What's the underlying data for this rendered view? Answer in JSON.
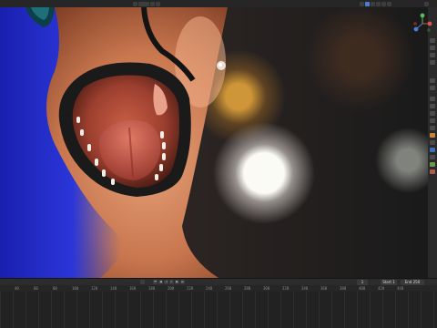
{
  "header": {
    "options_label": "Options",
    "icons": [
      "camera-icon",
      "select-icon",
      "overlay-icon",
      "shading-solid-icon",
      "shading-material-icon",
      "shading-rendered-icon"
    ]
  },
  "viewport": {
    "description_label": ""
  },
  "gizmo": {
    "x_label": "X",
    "y_label": "Y",
    "z_label": "Z"
  },
  "timeline": {
    "start_label": "Start",
    "start_value": "1",
    "end_label": "End",
    "end_value": "250",
    "current_frame": "1",
    "ticks": [
      "40",
      "60",
      "80",
      "100",
      "120",
      "140",
      "160",
      "180",
      "200",
      "220",
      "240",
      "260",
      "280",
      "300",
      "320",
      "340",
      "360",
      "380",
      "400",
      "420",
      "440"
    ]
  },
  "colors": {
    "accent": "#4f7bd1",
    "skin_blue": "#3344cc",
    "skin_orange": "#d88a5c",
    "mouth_interior": "#b8523f"
  }
}
